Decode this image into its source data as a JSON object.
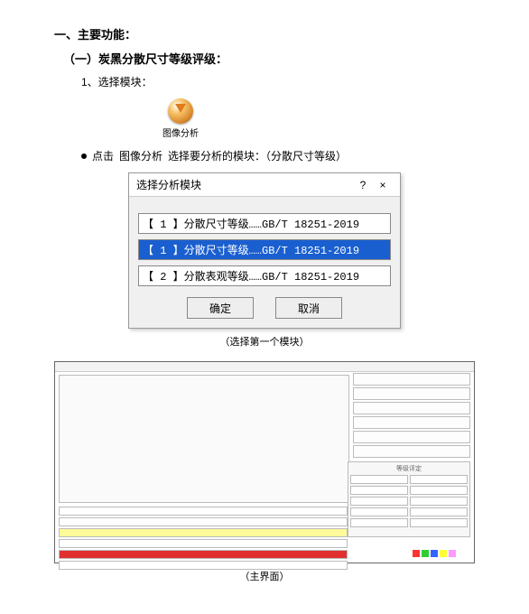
{
  "headings": {
    "h1": "一、主要功能：",
    "h2": "（一）炭黑分散尺寸等级评级：",
    "step1": "1、选择模块："
  },
  "toolbar_icon": {
    "label": "图像分析"
  },
  "bullet_line": {
    "prefix": "点击",
    "icon_text": "图像分析",
    "suffix": "选择要分析的模块：（分散尺寸等级）"
  },
  "dialog": {
    "title": "选择分析模块",
    "help": "?",
    "close": "×",
    "current": "【 1 】分散尺寸等级……GB/T 18251-2019",
    "opt1": "【 1 】分散尺寸等级……GB/T 18251-2019",
    "opt2": "【 2 】分散表观等级……GB/T 18251-2019",
    "ok": "确定",
    "cancel": "取消"
  },
  "captions": {
    "dialog": "（选择第一个模块）",
    "main": "（主界面）"
  },
  "mainui": {
    "panel_title": "等级评定"
  }
}
